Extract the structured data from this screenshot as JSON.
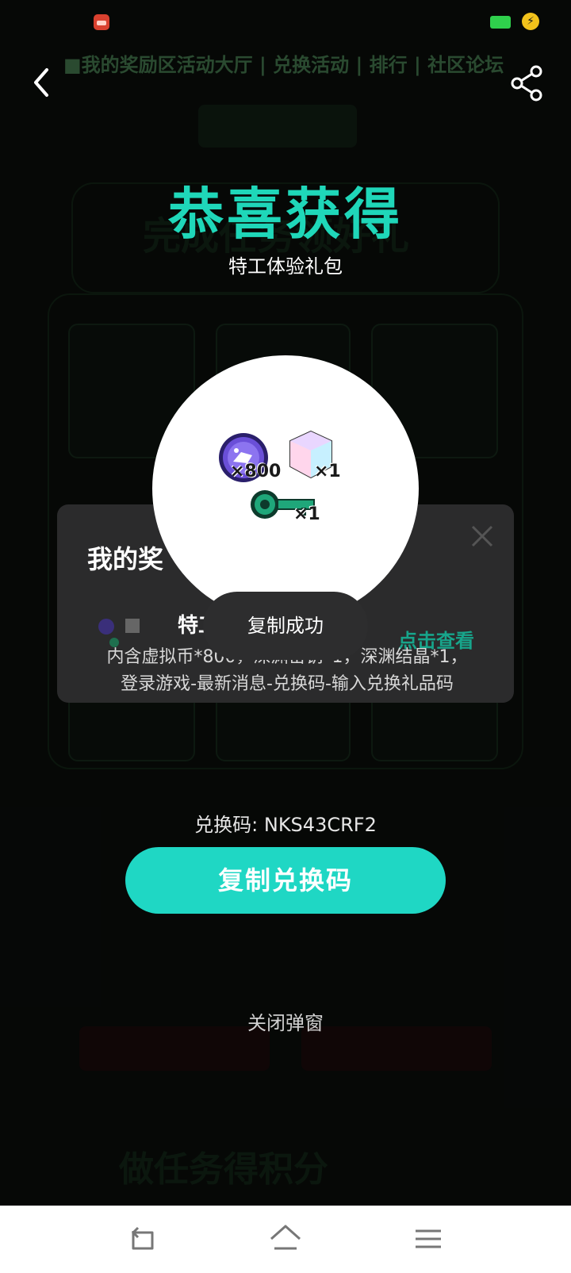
{
  "header": {
    "background_headline": "■我的奖励区活动大厅 | 兑换活动 | 排行 | 社区论坛",
    "back_icon": "chevron-left-icon",
    "share_icon": "share-icon"
  },
  "congrats": {
    "title": "恭喜获得",
    "subtitle": "特工体验礼包"
  },
  "rewards": [
    {
      "name": "coin-icon",
      "qty": "×800"
    },
    {
      "name": "crystal-cube-icon",
      "qty": "×1"
    },
    {
      "name": "key-icon",
      "qty": "×1"
    }
  ],
  "prize_panel": {
    "title": "我的奖",
    "item_name": "特工",
    "link": "点击查看",
    "description": "内含虚拟币*800，深渊密钥*1，深渊结晶*1，登录游戏-最新消息-兑换码-输入兑换礼品码"
  },
  "toast": {
    "text": "复制成功"
  },
  "redeem": {
    "code_text": "兑换码: NKS43CRF2",
    "copy_button": "复制兑换码",
    "close_link": "关闭弹窗"
  },
  "colors": {
    "accent": "#1fd7c4",
    "title_green": "#1fd7b9",
    "battery": "#2fd04c"
  },
  "navbar": {
    "back": "nav-back-icon",
    "home": "nav-home-icon",
    "menu": "nav-menu-icon"
  }
}
